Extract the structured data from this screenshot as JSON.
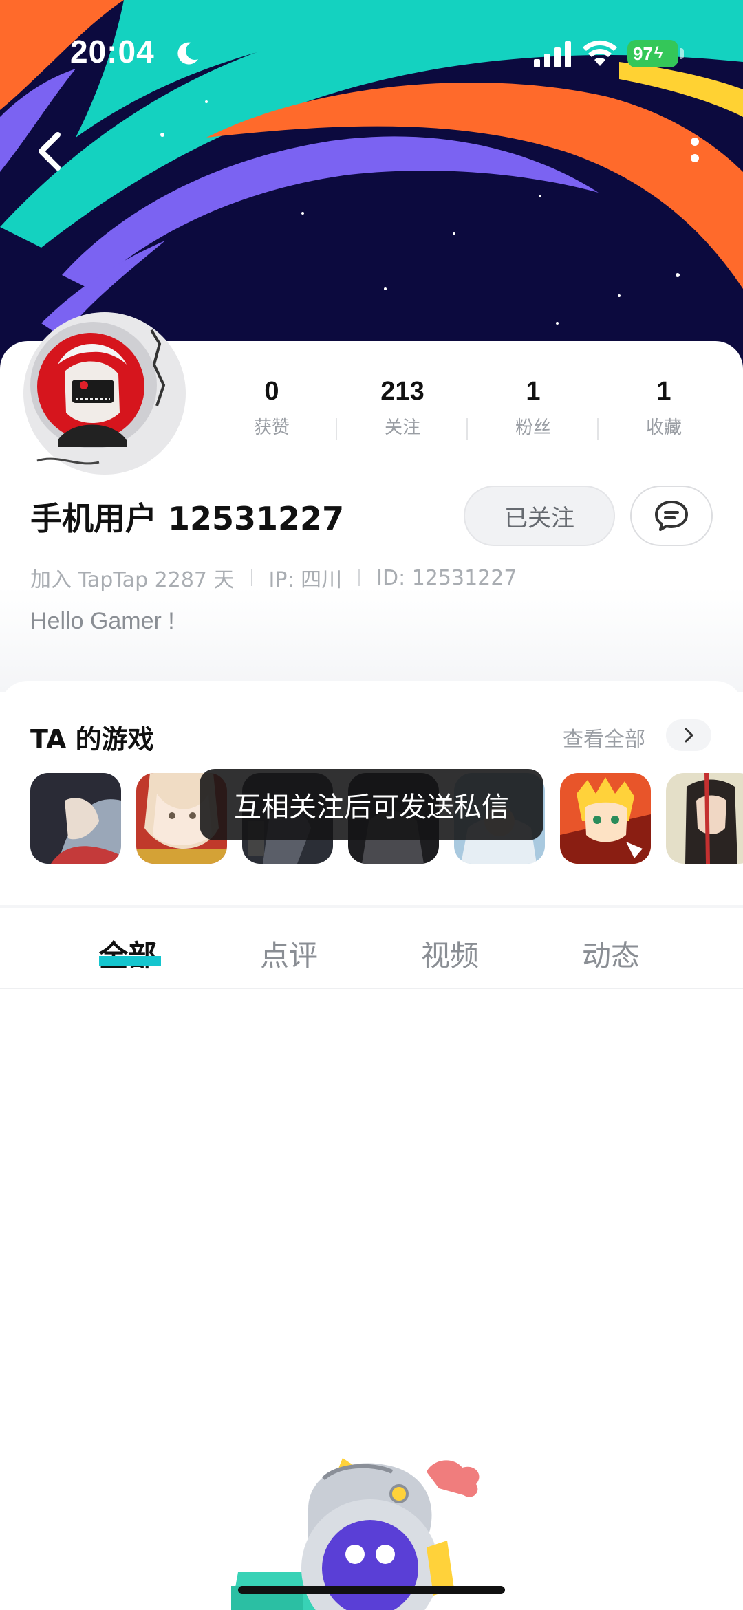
{
  "status_bar": {
    "time": "20:04",
    "battery": "97",
    "icons": [
      "moon-icon",
      "signal-icon",
      "wifi-icon",
      "battery-icon"
    ]
  },
  "nav": {
    "back_icon": "chevron-left-icon",
    "more_icon": "more-vertical-icon"
  },
  "profile": {
    "name": "手机用户 12531227",
    "stats": [
      {
        "value": "0",
        "label": "获赞"
      },
      {
        "value": "213",
        "label": "关注"
      },
      {
        "value": "1",
        "label": "粉丝"
      },
      {
        "value": "1",
        "label": "收藏"
      }
    ],
    "follow_label": "已关注",
    "message_icon": "chat-bubble-icon",
    "meta": {
      "joined": "加入 TapTap 2287 天",
      "ip": "IP: 四川",
      "id": "ID: 12531227"
    },
    "bio": "Hello Gamer !"
  },
  "games": {
    "title": "TA 的游戏",
    "view_all": "查看全部",
    "count_shown": 7
  },
  "toast": {
    "message": "互相关注后可发送私信"
  },
  "tabs": [
    {
      "label": "全部",
      "active": true
    },
    {
      "label": "点评",
      "active": false
    },
    {
      "label": "视频",
      "active": false
    },
    {
      "label": "动态",
      "active": false
    }
  ],
  "colors": {
    "banner_bg": "#0c0a3e",
    "teal": "#14d2c0",
    "orange": "#ff6a2b",
    "purple": "#7b63f2",
    "accent_underline": "#15c5ce",
    "battery_green": "#34c759"
  }
}
